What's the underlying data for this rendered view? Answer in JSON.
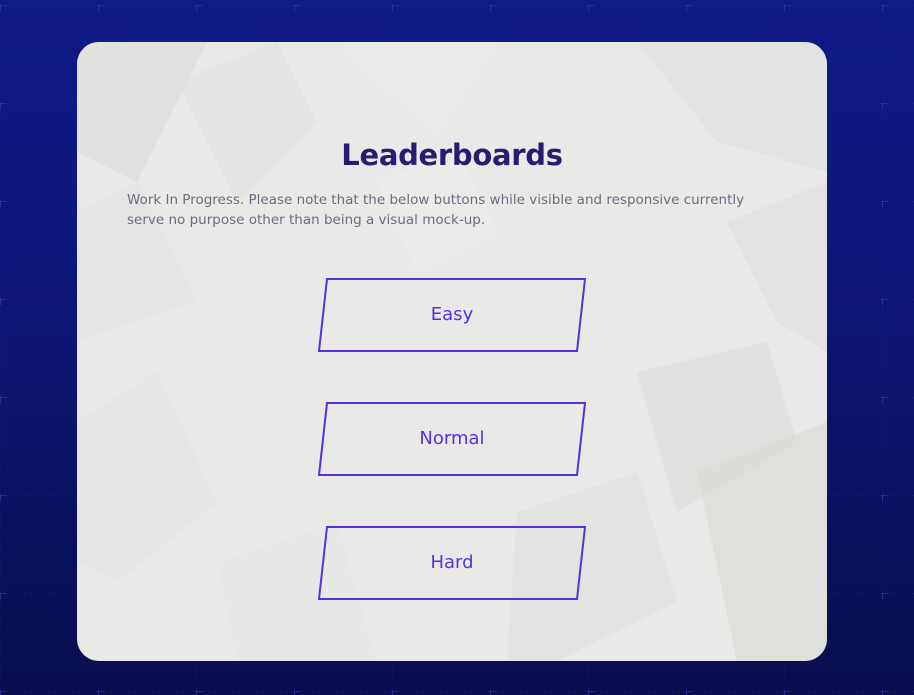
{
  "page": {
    "title": "Leaderboards",
    "notice": "Work In Progress. Please note that the below buttons while visible and responsive currently serve no purpose other than being a visual mock-up."
  },
  "buttons": {
    "easy": "Easy",
    "normal": "Normal",
    "hard": "Hard"
  },
  "colors": {
    "background": "#0d1778",
    "card": "#e9e9e7",
    "title": "#2b1a72",
    "accent": "#5a2fe0",
    "notice_text": "#6e6b80"
  }
}
